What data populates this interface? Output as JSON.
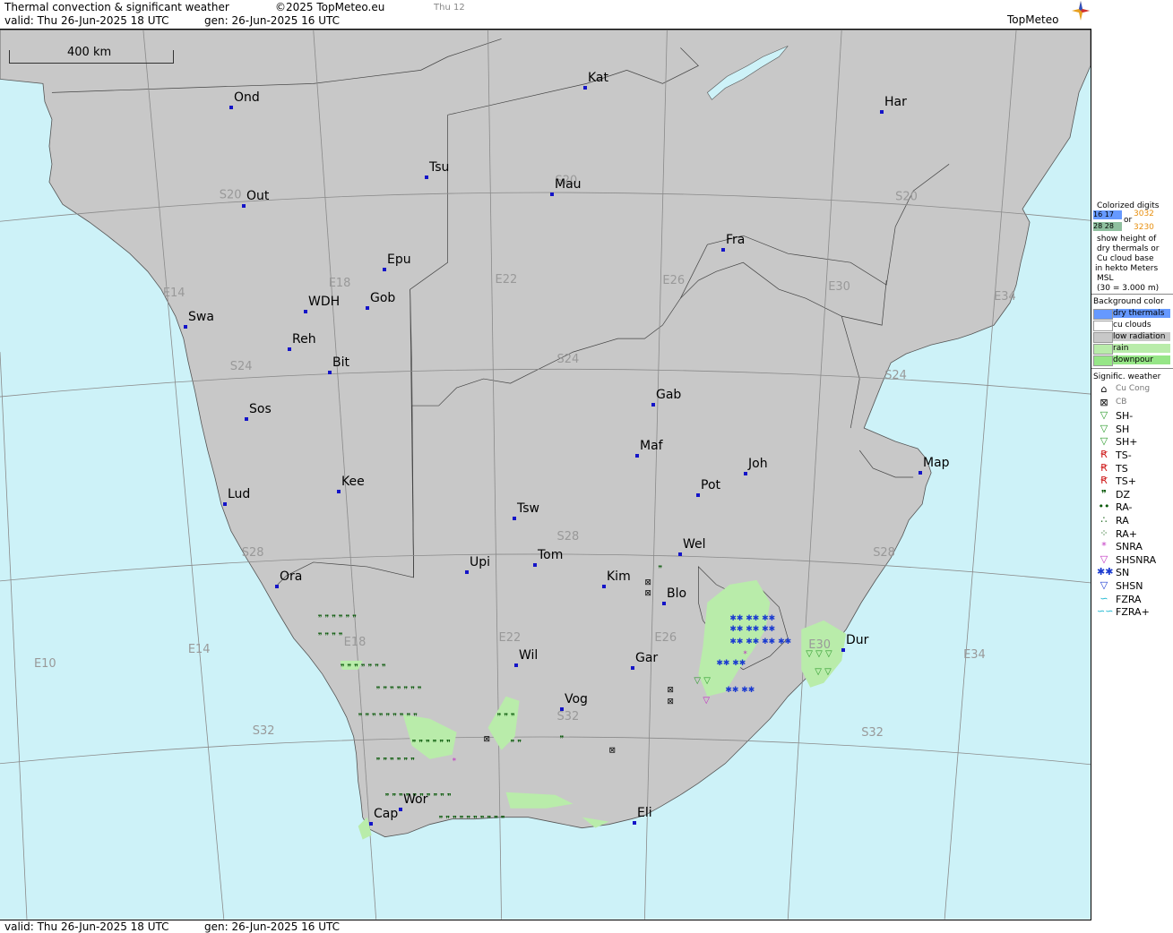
{
  "header": {
    "title": "Thermal convection & significant weather",
    "copyright": "©2025 TopMeteo.eu",
    "day_tag": "Thu 12",
    "valid": "valid:  Thu  26-Jun-2025  18 UTC",
    "gen": "gen:  26-Jun-2025 16 UTC",
    "logo": "TopMeteo"
  },
  "footer": {
    "valid": "valid:  Thu  26-Jun-2025  18 UTC",
    "gen": "gen:  26-Jun-2025 16 UTC"
  },
  "scale": {
    "label": "400 km"
  },
  "colors": {
    "sea": "#cdf2f8",
    "land": "#c8c8c8",
    "rain": "#b9ecaa",
    "downpour": "#96e687",
    "dry_thermals": "#6699ff",
    "city": "#1414c8",
    "grid": "#8a8a8a"
  },
  "cities": [
    {
      "id": "ond",
      "name": "Ond"
    },
    {
      "id": "kat",
      "name": "Kat"
    },
    {
      "id": "har",
      "name": "Har"
    },
    {
      "id": "tsu",
      "name": "Tsu"
    },
    {
      "id": "mau",
      "name": "Mau"
    },
    {
      "id": "out",
      "name": "Out"
    },
    {
      "id": "fra",
      "name": "Fra"
    },
    {
      "id": "epu",
      "name": "Epu"
    },
    {
      "id": "wdh",
      "name": "WDH"
    },
    {
      "id": "gob",
      "name": "Gob"
    },
    {
      "id": "swa",
      "name": "Swa"
    },
    {
      "id": "reh",
      "name": "Reh"
    },
    {
      "id": "bit",
      "name": "Bit"
    },
    {
      "id": "gab",
      "name": "Gab"
    },
    {
      "id": "sos",
      "name": "Sos"
    },
    {
      "id": "maf",
      "name": "Maf"
    },
    {
      "id": "joh",
      "name": "Joh"
    },
    {
      "id": "map",
      "name": "Map"
    },
    {
      "id": "kee",
      "name": "Kee"
    },
    {
      "id": "pot",
      "name": "Pot"
    },
    {
      "id": "lud",
      "name": "Lud"
    },
    {
      "id": "tsw",
      "name": "Tsw"
    },
    {
      "id": "wel",
      "name": "Wel"
    },
    {
      "id": "upi",
      "name": "Upi"
    },
    {
      "id": "tom",
      "name": "Tom"
    },
    {
      "id": "ora",
      "name": "Ora"
    },
    {
      "id": "kim",
      "name": "Kim"
    },
    {
      "id": "blo",
      "name": "Blo"
    },
    {
      "id": "dur",
      "name": "Dur"
    },
    {
      "id": "wil",
      "name": "Wil"
    },
    {
      "id": "gar",
      "name": "Gar"
    },
    {
      "id": "vog",
      "name": "Vog"
    },
    {
      "id": "wor",
      "name": "Wor"
    },
    {
      "id": "cap",
      "name": "Cap"
    },
    {
      "id": "eli",
      "name": "Eli"
    }
  ],
  "grid_labels": [
    "S20",
    "S20",
    "S20",
    "S24",
    "S24",
    "S24",
    "S28",
    "S28",
    "S28",
    "S32",
    "S32",
    "S32",
    "E10",
    "E14",
    "E14",
    "E18",
    "E18",
    "E22",
    "E22",
    "E26",
    "E26",
    "E30",
    "E30",
    "E34",
    "E34"
  ],
  "legend": {
    "colorized_title": "Colorized digits",
    "digits_a": "16 17",
    "digits_b": "3032",
    "or": "or",
    "digits_c": "28 28",
    "digits_d": "3230",
    "desc": [
      "show height of",
      "dry thermals or",
      "Cu cloud base",
      "in hekto Meters",
      "MSL",
      "(30 = 3.000 m)"
    ],
    "bg_title": "Background color",
    "bg_items": [
      {
        "label": "dry thermals",
        "color": "#6699ff"
      },
      {
        "label": "cu clouds",
        "color": "#ffffff"
      },
      {
        "label": "low radiation",
        "color": "#c8c8c8"
      },
      {
        "label": "rain",
        "color": "#b9ecaa"
      },
      {
        "label": "downpour",
        "color": "#96e687"
      }
    ],
    "wx_title": "Signific. weather",
    "wx_items": [
      {
        "label": "Cu Cong",
        "sym": "⌂",
        "color": "#000",
        "lcolor": "#777"
      },
      {
        "label": "CB",
        "sym": "⊠",
        "color": "#000",
        "lcolor": "#777"
      },
      {
        "label": "SH-",
        "sym": "▽",
        "color": "#2a9a2a",
        "lcolor": "#000"
      },
      {
        "label": "SH",
        "sym": "▽",
        "color": "#2a9a2a",
        "lcolor": "#000"
      },
      {
        "label": "SH+",
        "sym": "▽",
        "color": "#2a9a2a",
        "lcolor": "#000"
      },
      {
        "label": "TS-",
        "sym": "Ꞧ",
        "color": "#d02020",
        "lcolor": "#000"
      },
      {
        "label": "TS",
        "sym": "Ꞧ",
        "color": "#d02020",
        "lcolor": "#000"
      },
      {
        "label": "TS+",
        "sym": "Ꞧ",
        "color": "#d02020",
        "lcolor": "#000"
      },
      {
        "label": "DZ",
        "sym": "❞",
        "color": "#0a5a0a",
        "lcolor": "#000"
      },
      {
        "label": "RA-",
        "sym": "••",
        "color": "#0a5a0a",
        "lcolor": "#000"
      },
      {
        "label": "RA",
        "sym": "∴",
        "color": "#0a5a0a",
        "lcolor": "#000"
      },
      {
        "label": "RA+",
        "sym": "⁘",
        "color": "#0a5a0a",
        "lcolor": "#000"
      },
      {
        "label": "SNRA",
        "sym": "*",
        "color": "#c030c0",
        "lcolor": "#000"
      },
      {
        "label": "SHSNRA",
        "sym": "▽",
        "color": "#c030c0",
        "lcolor": "#000"
      },
      {
        "label": "SN",
        "sym": "✱✱",
        "color": "#1a3ad0",
        "lcolor": "#000"
      },
      {
        "label": "SHSN",
        "sym": "▽",
        "color": "#1a3ad0",
        "lcolor": "#000"
      },
      {
        "label": "FZRA",
        "sym": "∽",
        "color": "#19b6d0",
        "lcolor": "#000"
      },
      {
        "label": "FZRA+",
        "sym": "∽∽",
        "color": "#19b6d0",
        "lcolor": "#000"
      }
    ]
  }
}
